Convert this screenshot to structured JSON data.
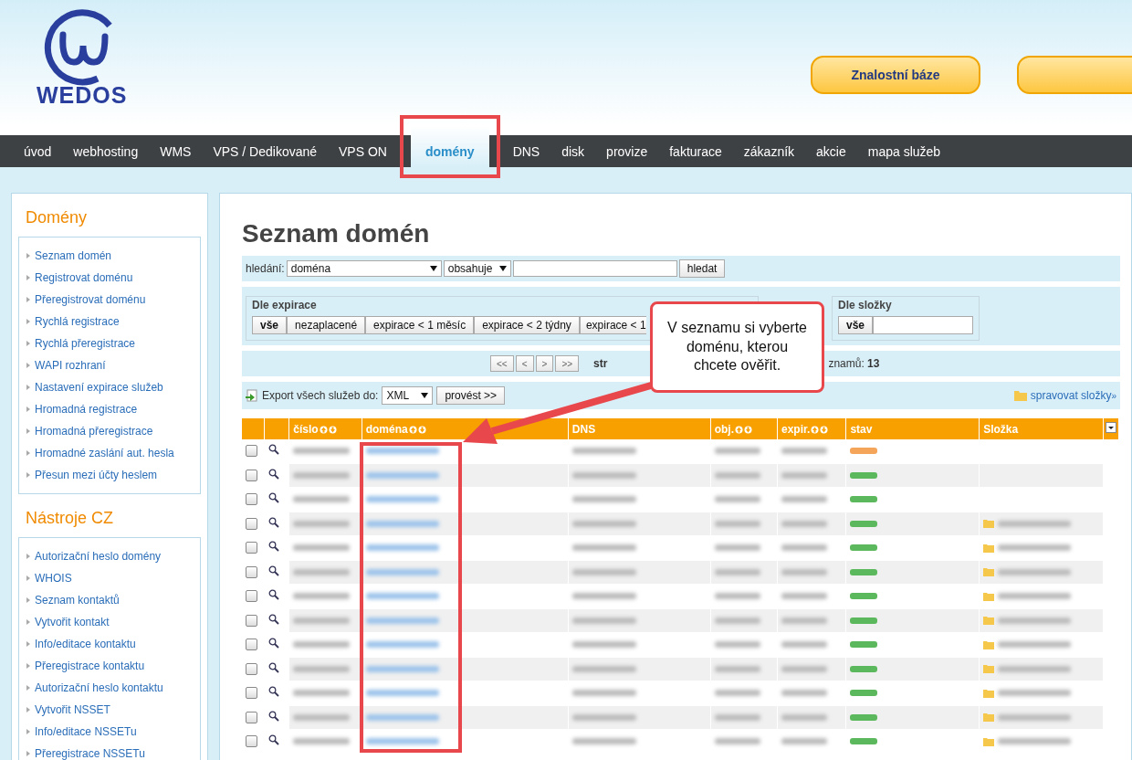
{
  "header": {
    "logo": "WEDOS",
    "buttons": [
      {
        "label": "Znalostní báze"
      }
    ]
  },
  "nav": [
    {
      "label": "úvod",
      "selected": false
    },
    {
      "label": "webhosting",
      "selected": false
    },
    {
      "label": "WMS",
      "selected": false
    },
    {
      "label": "VPS / Dedikované",
      "selected": false
    },
    {
      "label": "VPS ON",
      "selected": false
    },
    {
      "label": "domény",
      "selected": true
    },
    {
      "label": "DNS",
      "selected": false
    },
    {
      "label": "disk",
      "selected": false
    },
    {
      "label": "provize",
      "selected": false
    },
    {
      "label": "fakturace",
      "selected": false
    },
    {
      "label": "zákazník",
      "selected": false
    },
    {
      "label": "akcie",
      "selected": false
    },
    {
      "label": "mapa služeb",
      "selected": false
    }
  ],
  "sidebar": [
    {
      "title": "Domény",
      "items": [
        "Seznam domén",
        "Registrovat doménu",
        "Přeregistrovat doménu",
        "Rychlá registrace",
        "Rychlá přeregistrace",
        "WAPI rozhraní",
        "Nastavení expirace služeb",
        "Hromadná registrace",
        "Hromadná přeregistrace",
        "Hromadné zaslání aut. hesla",
        "Přesun mezi účty heslem"
      ]
    },
    {
      "title": "Nástroje CZ",
      "items": [
        "Autorizační heslo domény",
        "WHOIS",
        "Seznam kontaktů",
        "Vytvořit kontakt",
        "Info/editace kontaktu",
        "Přeregistrace kontaktu",
        "Autorizační heslo kontaktu",
        "Vytvořit NSSET",
        "Info/editace NSSETu",
        "Přeregistrace NSSETu"
      ]
    }
  ],
  "main": {
    "title": "Seznam domén",
    "search": {
      "label": "hledání:",
      "field": "doména",
      "operator": "obsahuje",
      "button": "hledat"
    },
    "expiry_filter": {
      "title": "Dle expirace",
      "buttons": [
        "vše",
        "nezaplacené",
        "expirace < 1 měsíc",
        "expirace < 2 týdny",
        "expirace < 1"
      ]
    },
    "folder_filter": {
      "title": "Dle složky",
      "buttons": [
        "vše"
      ]
    },
    "pager": {
      "buttons": [
        "<<",
        "<",
        ">",
        ">>"
      ],
      "page_fragment": "str",
      "count_fragment": "znamů:",
      "count": "13"
    },
    "export": {
      "label": "Export všech služeb do:",
      "format": "XML",
      "button": "provést >>",
      "manage_link": "spravovat složky",
      "manage_arrow": "»"
    },
    "table": {
      "columns": [
        {
          "label": "číslo",
          "sortable": true
        },
        {
          "label": "doména",
          "sortable": true
        },
        {
          "label": "DNS",
          "sortable": false
        },
        {
          "label": "obj.",
          "sortable": true
        },
        {
          "label": "expir.",
          "sortable": true
        },
        {
          "label": "stav",
          "sortable": false
        },
        {
          "label": "Složka",
          "sortable": false
        }
      ],
      "rows": [
        {
          "checked": false,
          "color": "#f5a55a",
          "folder": false
        },
        {
          "checked": false,
          "color": "#5cb85c",
          "folder": false
        },
        {
          "checked": false,
          "color": "#5cb85c",
          "folder": false
        },
        {
          "checked": false,
          "color": "#5cb85c",
          "folder": true
        },
        {
          "checked": false,
          "color": "#5cb85c",
          "folder": true
        },
        {
          "checked": false,
          "color": "#5cb85c",
          "folder": true
        },
        {
          "checked": false,
          "color": "#5cb85c",
          "folder": true
        },
        {
          "checked": false,
          "color": "#5cb85c",
          "folder": true
        },
        {
          "checked": false,
          "color": "#5cb85c",
          "folder": true
        },
        {
          "checked": false,
          "color": "#5cb85c",
          "folder": true
        },
        {
          "checked": false,
          "color": "#5cb85c",
          "folder": true
        },
        {
          "checked": false,
          "color": "#5cb85c",
          "folder": true
        },
        {
          "checked": false,
          "color": "#5cb85c",
          "folder": true
        }
      ]
    }
  },
  "callout": {
    "text": "V seznamu si vyberte doménu, kterou chcete ověřit."
  }
}
